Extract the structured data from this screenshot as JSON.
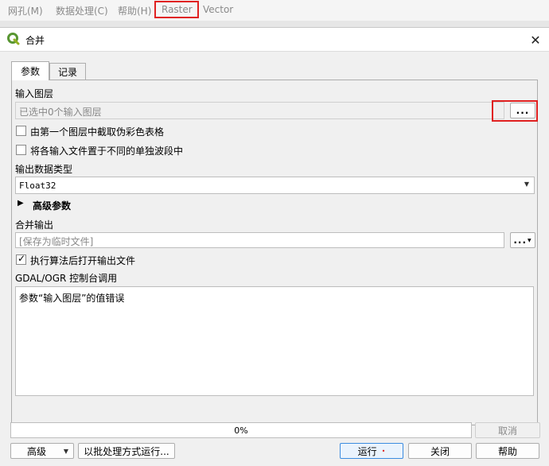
{
  "menubar": {
    "items": [
      "网孔(M)",
      "数据处理(C)",
      "帮助(H)",
      "Raster",
      "Vector"
    ]
  },
  "dialog": {
    "title": "合并",
    "close_glyph": "✕",
    "tabs": [
      "参数",
      "记录"
    ],
    "input_layers": {
      "label": "输入图层",
      "placeholder": "已选中0个输入图层",
      "browse_label": "..."
    },
    "checkbox_grab_pct": {
      "label": "由第一个图层中截取伪彩色表格",
      "checked": false
    },
    "checkbox_separate": {
      "label": "将各输入文件置于不同的单独波段中",
      "checked": false
    },
    "output_type": {
      "label": "输出数据类型",
      "value": "Float32"
    },
    "advanced": {
      "label": "高级参数"
    },
    "merge_output": {
      "label": "合并输出",
      "placeholder": "[保存为临时文件]",
      "browse_label": "..."
    },
    "open_after": {
      "label": "执行算法后打开输出文件",
      "checked": true
    },
    "console": {
      "label": "GDAL/OGR 控制台调用",
      "text": "参数“输入图层”的值错误"
    },
    "progress": {
      "text": "0%",
      "value": 0
    },
    "buttons": {
      "cancel": "取消",
      "advanced": "高级",
      "batch": "以批处理方式运行...",
      "run": "运行",
      "close": "关闭",
      "help": "帮助"
    }
  }
}
